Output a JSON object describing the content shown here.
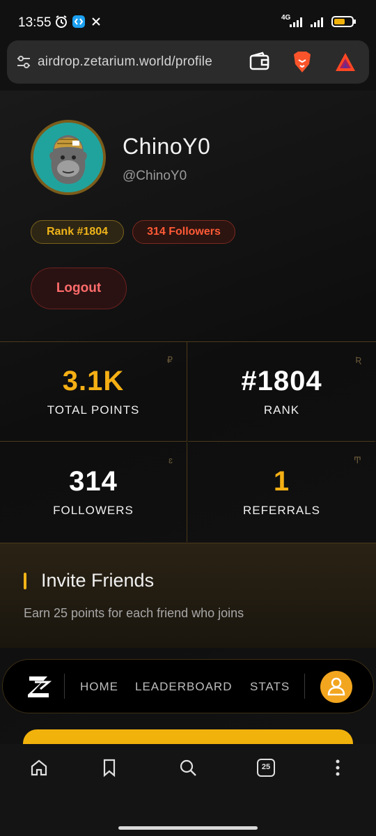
{
  "status_bar": {
    "time": "13:55",
    "network_label": "4G",
    "icons": [
      "alarm-icon",
      "shazam-icon",
      "x-icon",
      "signal-icon",
      "wifi-signal-icon",
      "battery-icon"
    ]
  },
  "browser": {
    "url": "airdrop.zetarium.world/profile",
    "icons": [
      "site-settings-icon",
      "wallet-icon",
      "brave-lion-icon",
      "bat-rewards-icon"
    ]
  },
  "profile": {
    "display_name": "ChinoY0",
    "handle": "@ChinoY0",
    "rank_badge": "Rank #1804",
    "followers_badge": "314 Followers",
    "logout_label": "Logout"
  },
  "stats": [
    {
      "value": "3.1K",
      "label": "TOTAL POINTS",
      "color": "#f5b014"
    },
    {
      "value": "#1804",
      "label": "RANK",
      "color": "#ffffff"
    },
    {
      "value": "314",
      "label": "FOLLOWERS",
      "color": "#ffffff"
    },
    {
      "value": "1",
      "label": "REFERRALS",
      "color": "#f5b014"
    }
  ],
  "invite": {
    "title": "Invite Friends",
    "subtitle": "Earn 25 points for each friend who joins"
  },
  "site_nav": {
    "logo_letter": "Z",
    "links": [
      "HOME",
      "LEADERBOARD",
      "STATS"
    ]
  },
  "bottom_bar": {
    "tab_count": "25"
  },
  "colors": {
    "accent": "#f2b20c",
    "danger": "#ff6b6b",
    "followers_accent": "#ff5a36"
  }
}
